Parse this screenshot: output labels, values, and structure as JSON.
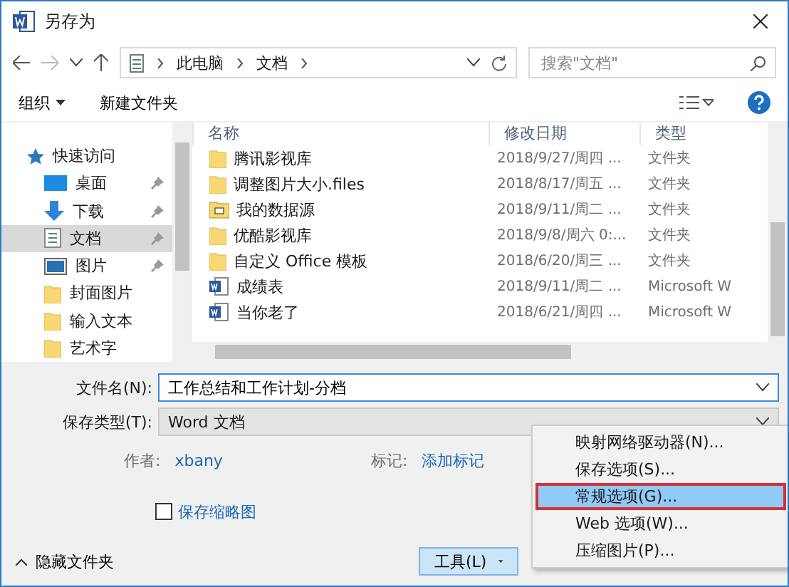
{
  "window": {
    "title": "另存为"
  },
  "nav": {
    "breadcrumbs": [
      "此电脑",
      "文档"
    ],
    "search": {
      "placeholder": "搜索\"文档\""
    }
  },
  "toolbar": {
    "organize": "组织",
    "new_folder": "新建文件夹"
  },
  "sidebar": {
    "items": [
      {
        "label": "快速访问",
        "kind": "star",
        "pinned": false,
        "selected": false
      },
      {
        "label": "桌面",
        "kind": "desktop",
        "pinned": true,
        "selected": false
      },
      {
        "label": "下载",
        "kind": "download",
        "pinned": true,
        "selected": false
      },
      {
        "label": "文档",
        "kind": "document",
        "pinned": true,
        "selected": true
      },
      {
        "label": "图片",
        "kind": "picture",
        "pinned": true,
        "selected": false
      },
      {
        "label": "封面图片",
        "kind": "folder",
        "pinned": false,
        "selected": false
      },
      {
        "label": "输入文本",
        "kind": "folder",
        "pinned": false,
        "selected": false
      },
      {
        "label": "艺术字",
        "kind": "folder",
        "pinned": false,
        "selected": false
      }
    ]
  },
  "table": {
    "columns": [
      "名称",
      "修改日期",
      "类型"
    ],
    "rows": [
      {
        "name": "腾讯影视库",
        "date": "2018/9/27/周四 ...",
        "type": "文件夹",
        "kind": "folder"
      },
      {
        "name": "调整图片大小.files",
        "date": "2018/8/17/周五 ...",
        "type": "文件夹",
        "kind": "folder"
      },
      {
        "name": "我的数据源",
        "date": "2018/9/11/周二 ...",
        "type": "文件夹",
        "kind": "datasource"
      },
      {
        "name": "优酷影视库",
        "date": "2018/9/8/周六 0:...",
        "type": "文件夹",
        "kind": "folder"
      },
      {
        "name": "自定义 Office 模板",
        "date": "2018/6/20/周三 ...",
        "type": "文件夹",
        "kind": "folder"
      },
      {
        "name": "成绩表",
        "date": "2018/9/11/周二 ...",
        "type": "Microsoft W",
        "kind": "word"
      },
      {
        "name": "当你老了",
        "date": "2018/6/21/周四 ...",
        "type": "Microsoft W",
        "kind": "word"
      }
    ]
  },
  "form": {
    "filename": {
      "label": "文件名(N):",
      "value": "工作总结和工作计划-分档"
    },
    "save_type": {
      "label": "保存类型(T):",
      "value": "Word 文档"
    },
    "author": {
      "label": "作者:",
      "value": "xbany"
    },
    "tags": {
      "label": "标记:",
      "value": "添加标记"
    },
    "thumbnail": {
      "label": "保存缩略图",
      "checked": false
    }
  },
  "footer": {
    "hide_folders": "隐藏文件夹",
    "tools": "工具(L)"
  },
  "menu": {
    "items": [
      {
        "label": "映射网络驱动器(N)...",
        "selected": false
      },
      {
        "label": "保存选项(S)...",
        "selected": false
      },
      {
        "label": "常规选项(G)...",
        "selected": true
      },
      {
        "label": "Web 选项(W)...",
        "selected": false
      },
      {
        "label": "压缩图片(P)...",
        "selected": false
      }
    ]
  }
}
